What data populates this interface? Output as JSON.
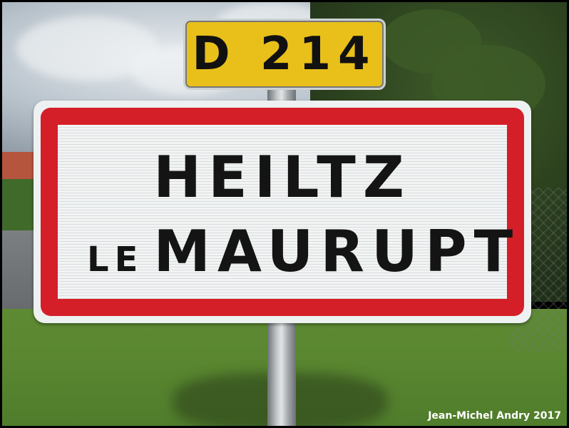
{
  "road_plate": {
    "text": "D 214",
    "color": "#e9c01a"
  },
  "town_sign": {
    "line1": "HEILTZ",
    "line2_small": "LE",
    "line2_big": "MAURUPT",
    "border_color": "#d51f28"
  },
  "watermark": "Jean-Michel Andry 2017"
}
